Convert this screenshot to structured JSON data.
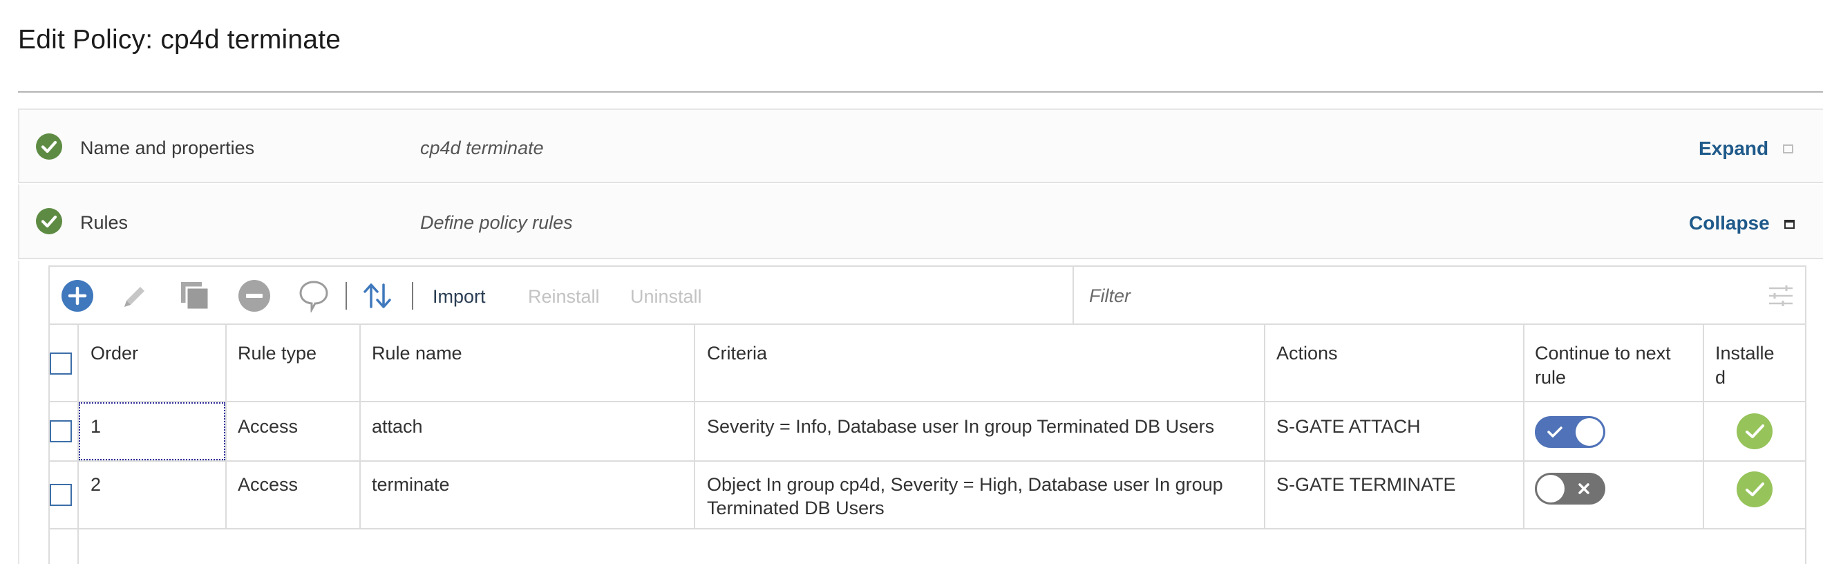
{
  "page": {
    "title": "Edit Policy: cp4d terminate"
  },
  "sections": [
    {
      "label": "Name and properties",
      "description": "cp4d terminate",
      "action": "Expand",
      "state": "collapsed"
    },
    {
      "label": "Rules",
      "description": "Define policy rules",
      "action": "Collapse",
      "state": "expanded"
    }
  ],
  "toolbar": {
    "icons": [
      "add-icon",
      "edit-icon",
      "copy-icon",
      "remove-icon",
      "comment-icon",
      "sort-icon",
      "filter-options-icon"
    ],
    "import_label": "Import",
    "reinstall_label": "Reinstall",
    "uninstall_label": "Uninstall",
    "filter_placeholder": "Filter"
  },
  "table": {
    "headers": {
      "order": "Order",
      "rule_type": "Rule type",
      "rule_name": "Rule name",
      "criteria": "Criteria",
      "actions": "Actions",
      "continue_line1": "Continue to next",
      "continue_line2": "rule",
      "installed_line1": "Installe",
      "installed_line2": "d"
    },
    "rows": [
      {
        "order": "1",
        "rule_type": "Access",
        "rule_name": "attach",
        "criteria": "Severity = Info, Database user In group Terminated DB Users",
        "criteria_line2": "",
        "actions": "S-GATE ATTACH",
        "continue_to_next_rule": true,
        "installed": true
      },
      {
        "order": "2",
        "rule_type": "Access",
        "rule_name": "terminate",
        "criteria": "Object In group cp4d, Severity = High, Database user In group",
        "criteria_line2": "Terminated DB Users",
        "actions": "S-GATE TERMINATE",
        "continue_to_next_rule": false,
        "installed": true
      }
    ]
  },
  "colors": {
    "section_check": "#5d8b43",
    "installed_check": "#96c35a",
    "toggle_on": "#4f72b8",
    "toggle_off": "#727272",
    "link": "#1f5a8a",
    "add_button": "#3f78bc"
  }
}
